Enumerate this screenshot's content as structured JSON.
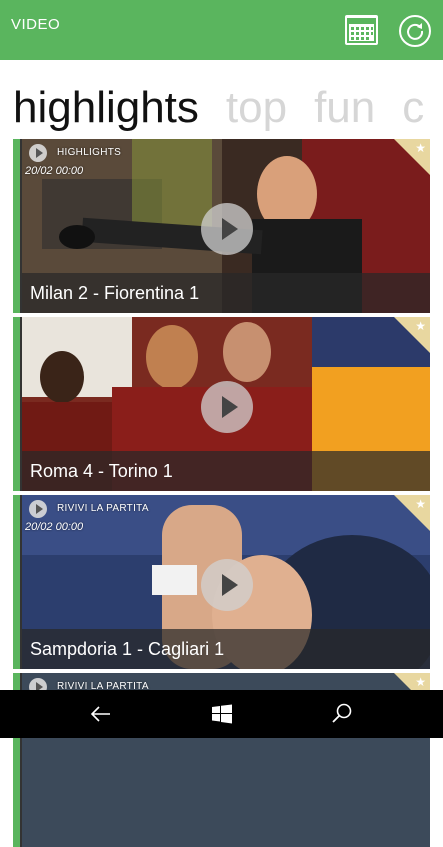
{
  "app": {
    "title": "VIDEO"
  },
  "pivot": {
    "tabs": [
      "highlights",
      "top",
      "fun",
      "c"
    ]
  },
  "videos": [
    {
      "category": "HIGHLIGHTS",
      "date": "20/02 00:00",
      "title": "Milan 2  -  Fiorentina 1"
    },
    {
      "category": "",
      "date": "",
      "title": "Roma 4  -  Torino 1"
    },
    {
      "category": "RIVIVI LA PARTITA",
      "date": "20/02 00:00",
      "title": "Sampdoria 1  -  Cagliari 1"
    },
    {
      "category": "RIVIVI LA PARTITA",
      "date": "",
      "title": ""
    }
  ],
  "icons": {
    "calendar": "calendar-icon",
    "refresh": "refresh-icon",
    "back": "back-arrow-icon",
    "start": "windows-logo-icon",
    "search": "search-icon",
    "favorite": "star-icon",
    "play": "play-icon"
  },
  "colors": {
    "accent": "#5ab55e",
    "fav_corner": "#e8d7a0",
    "nav_bar": "#000000"
  }
}
